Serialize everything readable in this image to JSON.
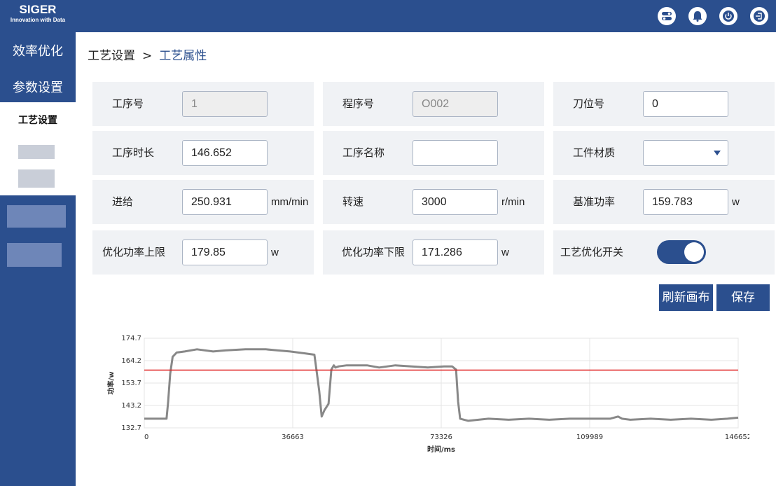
{
  "brand": {
    "name": "SIGER",
    "tagline": "Innovation with Data"
  },
  "header_icons": [
    "toggle-icon",
    "bell-icon",
    "power-icon",
    "exit-icon"
  ],
  "sidebar": {
    "items": [
      {
        "label": "效率优化"
      },
      {
        "label": "参数设置"
      },
      {
        "label": "工艺设置",
        "active": true
      }
    ]
  },
  "breadcrumb": {
    "parent": "工艺设置",
    "separator": ">",
    "current": "工艺属性"
  },
  "form": {
    "process_no": {
      "label": "工序号",
      "value": "1"
    },
    "program_no": {
      "label": "程序号",
      "value": "O002"
    },
    "tool_no": {
      "label": "刀位号",
      "value": "0"
    },
    "process_duration": {
      "label": "工序时长",
      "value": "146.652"
    },
    "process_name": {
      "label": "工序名称",
      "value": ""
    },
    "material": {
      "label": "工件材质",
      "value": ""
    },
    "feed": {
      "label": "进给",
      "value": "250.931",
      "unit": "mm/min"
    },
    "speed": {
      "label": "转速",
      "value": "3000",
      "unit": "r/min"
    },
    "base_power": {
      "label": "基准功率",
      "value": "159.783",
      "unit": "w"
    },
    "power_upper": {
      "label": "优化功率上限",
      "value": "179.85",
      "unit": "w"
    },
    "power_lower": {
      "label": "优化功率下限",
      "value": "171.286",
      "unit": "w"
    },
    "opt_switch": {
      "label": "工艺优化开关",
      "on": true
    }
  },
  "buttons": {
    "refresh": "刷新画布",
    "save": "保存"
  },
  "colors": {
    "primary": "#2b4f8e",
    "line": "#888888",
    "reference": "#e02020"
  },
  "chart_data": {
    "type": "line",
    "title": "",
    "xlabel": "时间/ms",
    "ylabel": "功率/w",
    "xlim": [
      0,
      146652
    ],
    "ylim": [
      132.7,
      174.7
    ],
    "x_ticks": [
      "0",
      "36663",
      "73326",
      "109989",
      "146652"
    ],
    "y_ticks": [
      "174.7",
      "164.2",
      "153.7",
      "143.2",
      "132.7"
    ],
    "grid": true,
    "series": [
      {
        "color": "#888888",
        "x": [
          0,
          5500,
          5900,
          6400,
          7000,
          8000,
          10000,
          13000,
          17000,
          20000,
          25000,
          30000,
          33000,
          36000,
          40000,
          42000,
          42500,
          43200,
          43800,
          44500,
          45500,
          46200,
          46800,
          47200,
          48000,
          50000,
          55000,
          58000,
          62000,
          66000,
          70000,
          74000,
          76000,
          77000,
          77500,
          78000,
          80000,
          85000,
          90000,
          95000,
          100000,
          105000,
          110000,
          115000,
          117000,
          118000,
          120000,
          125000,
          130000,
          135000,
          140000,
          144000,
          146652
        ],
        "y": [
          137,
          137,
          145,
          158,
          166,
          168,
          168.5,
          169.5,
          168.5,
          169,
          169.5,
          169.5,
          169,
          168.5,
          167.5,
          167,
          160,
          150,
          138,
          141,
          144,
          160,
          162,
          161,
          161.5,
          162,
          162,
          161,
          162,
          161.5,
          161,
          161.5,
          161.5,
          160,
          145,
          137,
          136,
          137,
          136.5,
          137,
          136.5,
          137,
          137,
          137,
          138,
          137,
          136.5,
          137,
          136.5,
          137,
          136.5,
          137,
          137.5
        ]
      },
      {
        "color": "#e02020",
        "x": [
          0,
          146652
        ],
        "y": [
          159.783,
          159.783
        ]
      }
    ]
  }
}
